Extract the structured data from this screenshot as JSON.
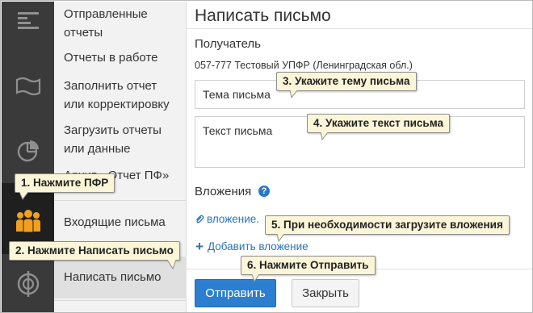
{
  "nav": {
    "items": [
      {
        "label_1": "Отправленные",
        "label_2": "отчеты"
      },
      {
        "label_1": "Отчеты в работе"
      },
      {
        "label_1": "Заполнить отчет",
        "label_2": "или корректировку"
      },
      {
        "label_1": "Загрузить отчеты",
        "label_2": "или данные"
      },
      {
        "label_1": "Архив «Отчет ПФ»"
      },
      {
        "label_1": "Входящие письма"
      },
      {
        "label_1": "Написать письмо"
      }
    ]
  },
  "rail": {
    "icons": [
      "menu-icon",
      "flag-icon",
      "pie-chart-icon",
      "people-icon",
      "pfr-logo-icon"
    ],
    "active": "people-icon",
    "active_color": "#f0a01e"
  },
  "main": {
    "title": "Написать письмо",
    "recipient_label": "Получатель",
    "recipient": "057-777 Тестовый УПФР (Ленинградская обл.)",
    "subject_placeholder": "Тема письма",
    "body_placeholder": "Текст письма",
    "attachments_label": "Вложения",
    "help_icon": "?",
    "attachment_file": "вложение.",
    "add_attachment": "Добавить вложение",
    "send_button": "Отправить",
    "close_button": "Закрыть"
  },
  "callouts": {
    "step1": "1. Нажмите ПФР",
    "step2": "2. Нажмите Написать письмо",
    "step3": "3. Укажите тему письма",
    "step4": "4. Укажите текст письма",
    "step5": "5. При необходимости загрузите вложения",
    "step6": "6. Нажмите Отправить"
  },
  "colors": {
    "accent": "#2c7fd0",
    "link": "#2b72b8",
    "callout_bg": "#fcf6d8",
    "rail_bg": "#3a3a3a"
  }
}
